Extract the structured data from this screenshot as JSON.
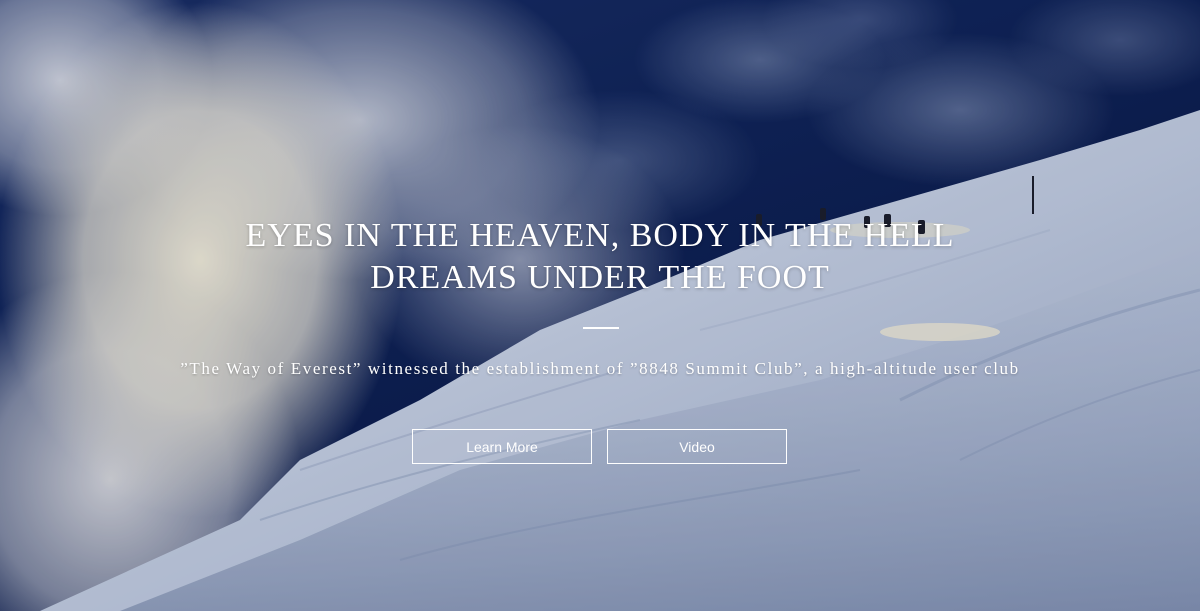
{
  "hero": {
    "headline_line1": "EYES IN THE HEAVEN, BODY IN THE HELL",
    "headline_line2": "DREAMS UNDER THE FOOT",
    "subtitle": "”The Way of Everest” witnessed the establishment of ”8848 Summit Club”, a high-altitude user club",
    "buttons": {
      "learn_more": "Learn More",
      "video": "Video"
    }
  },
  "colors": {
    "text": "#ffffff",
    "sky": "#0f2358",
    "snow": "#d8dfee"
  }
}
